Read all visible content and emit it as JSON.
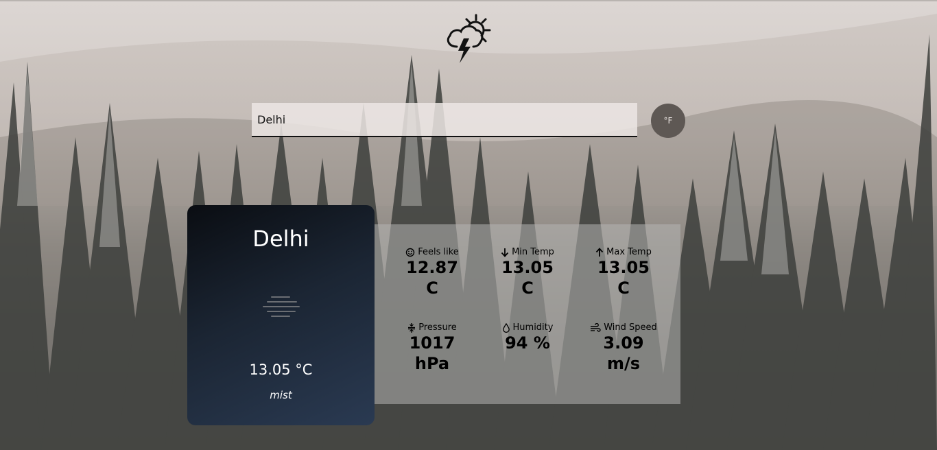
{
  "search": {
    "value": "Delhi"
  },
  "unit_toggle": {
    "label": "°F"
  },
  "city_card": {
    "city": "Delhi",
    "temperature": "13.05 °C",
    "description": "mist",
    "icon": "mist-icon"
  },
  "details": [
    {
      "label": "Feels like",
      "value": "12.87",
      "unit": "C",
      "icon": "smile-icon"
    },
    {
      "label": "Min Temp",
      "value": "13.05",
      "unit": "C",
      "icon": "arrow-down-icon"
    },
    {
      "label": "Max Temp",
      "value": "13.05",
      "unit": "C",
      "icon": "arrow-up-icon"
    },
    {
      "label": "Pressure",
      "value": "1017",
      "unit": "hPa",
      "icon": "pressure-icon"
    },
    {
      "label": "Humidity",
      "value": "94 %",
      "unit": "",
      "icon": "droplet-icon"
    },
    {
      "label": "Wind Speed",
      "value": "3.09",
      "unit": "m/s",
      "icon": "wind-icon"
    }
  ],
  "logo": {
    "icon": "thunderstorm-sun-icon"
  }
}
